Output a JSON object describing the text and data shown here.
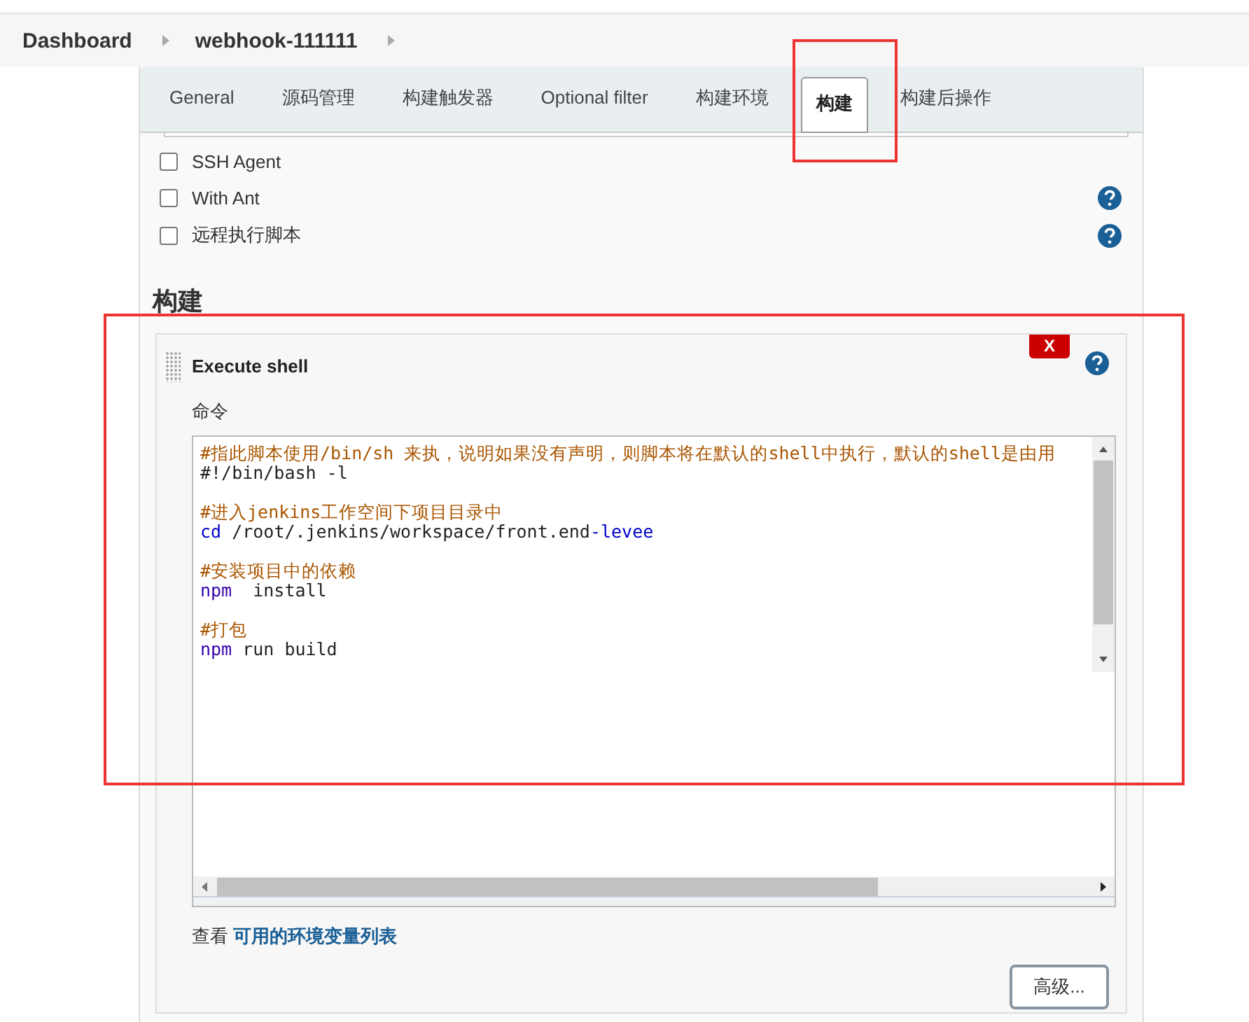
{
  "breadcrumbs": [
    {
      "label": "Dashboard"
    },
    {
      "label": "webhook-111111"
    }
  ],
  "tabs": [
    {
      "label": "General",
      "selected": false
    },
    {
      "label": "源码管理",
      "selected": false
    },
    {
      "label": "构建触发器",
      "selected": false
    },
    {
      "label": "Optional filter",
      "selected": false
    },
    {
      "label": "构建环境",
      "selected": false
    },
    {
      "label": "构建",
      "selected": true
    },
    {
      "label": "构建后操作",
      "selected": false
    }
  ],
  "options": [
    {
      "label": "SSH Agent",
      "checked": false,
      "help": false
    },
    {
      "label": "With Ant",
      "checked": false,
      "help": true
    },
    {
      "label": "远程执行脚本",
      "checked": false,
      "help": true
    }
  ],
  "section_title": "构建",
  "step": {
    "title": "Execute shell",
    "delete_label": "X",
    "command_label": "命令",
    "command_blocks": [
      [
        [
          {
            "text": "#指此脚本使用/bin/sh 来执，说明如果没有声明，则脚本将在默认的shell中执行，默认的shell是由用",
            "kind": "comment"
          }
        ],
        [
          {
            "text": "#!/bin/bash -l",
            "kind": "plain"
          }
        ]
      ],
      [
        [
          {
            "text": "#进入jenkins工作空间下项目目录中",
            "kind": "comment"
          }
        ],
        [
          {
            "text": "cd",
            "kind": "builtin"
          },
          {
            "text": " /root/.jenkins/workspace/front.end",
            "kind": "plain"
          },
          {
            "text": "-levee",
            "kind": "builtin"
          }
        ]
      ],
      [
        [
          {
            "text": "#安装项目中的依赖",
            "kind": "comment"
          }
        ],
        [
          {
            "text": "npm",
            "kind": "keyword"
          },
          {
            "text": "  install",
            "kind": "plain"
          }
        ]
      ],
      [
        [
          {
            "text": "#打包",
            "kind": "comment"
          }
        ],
        [
          {
            "text": "npm",
            "kind": "keyword"
          },
          {
            "text": " run build",
            "kind": "plain"
          }
        ]
      ]
    ],
    "env_prefix": "查看",
    "env_link": "可用的环境变量列表",
    "advanced_button": "高级..."
  },
  "annotation_boxes": [
    {
      "color": "#ee3333"
    },
    {
      "color": "#ee3333"
    }
  ]
}
